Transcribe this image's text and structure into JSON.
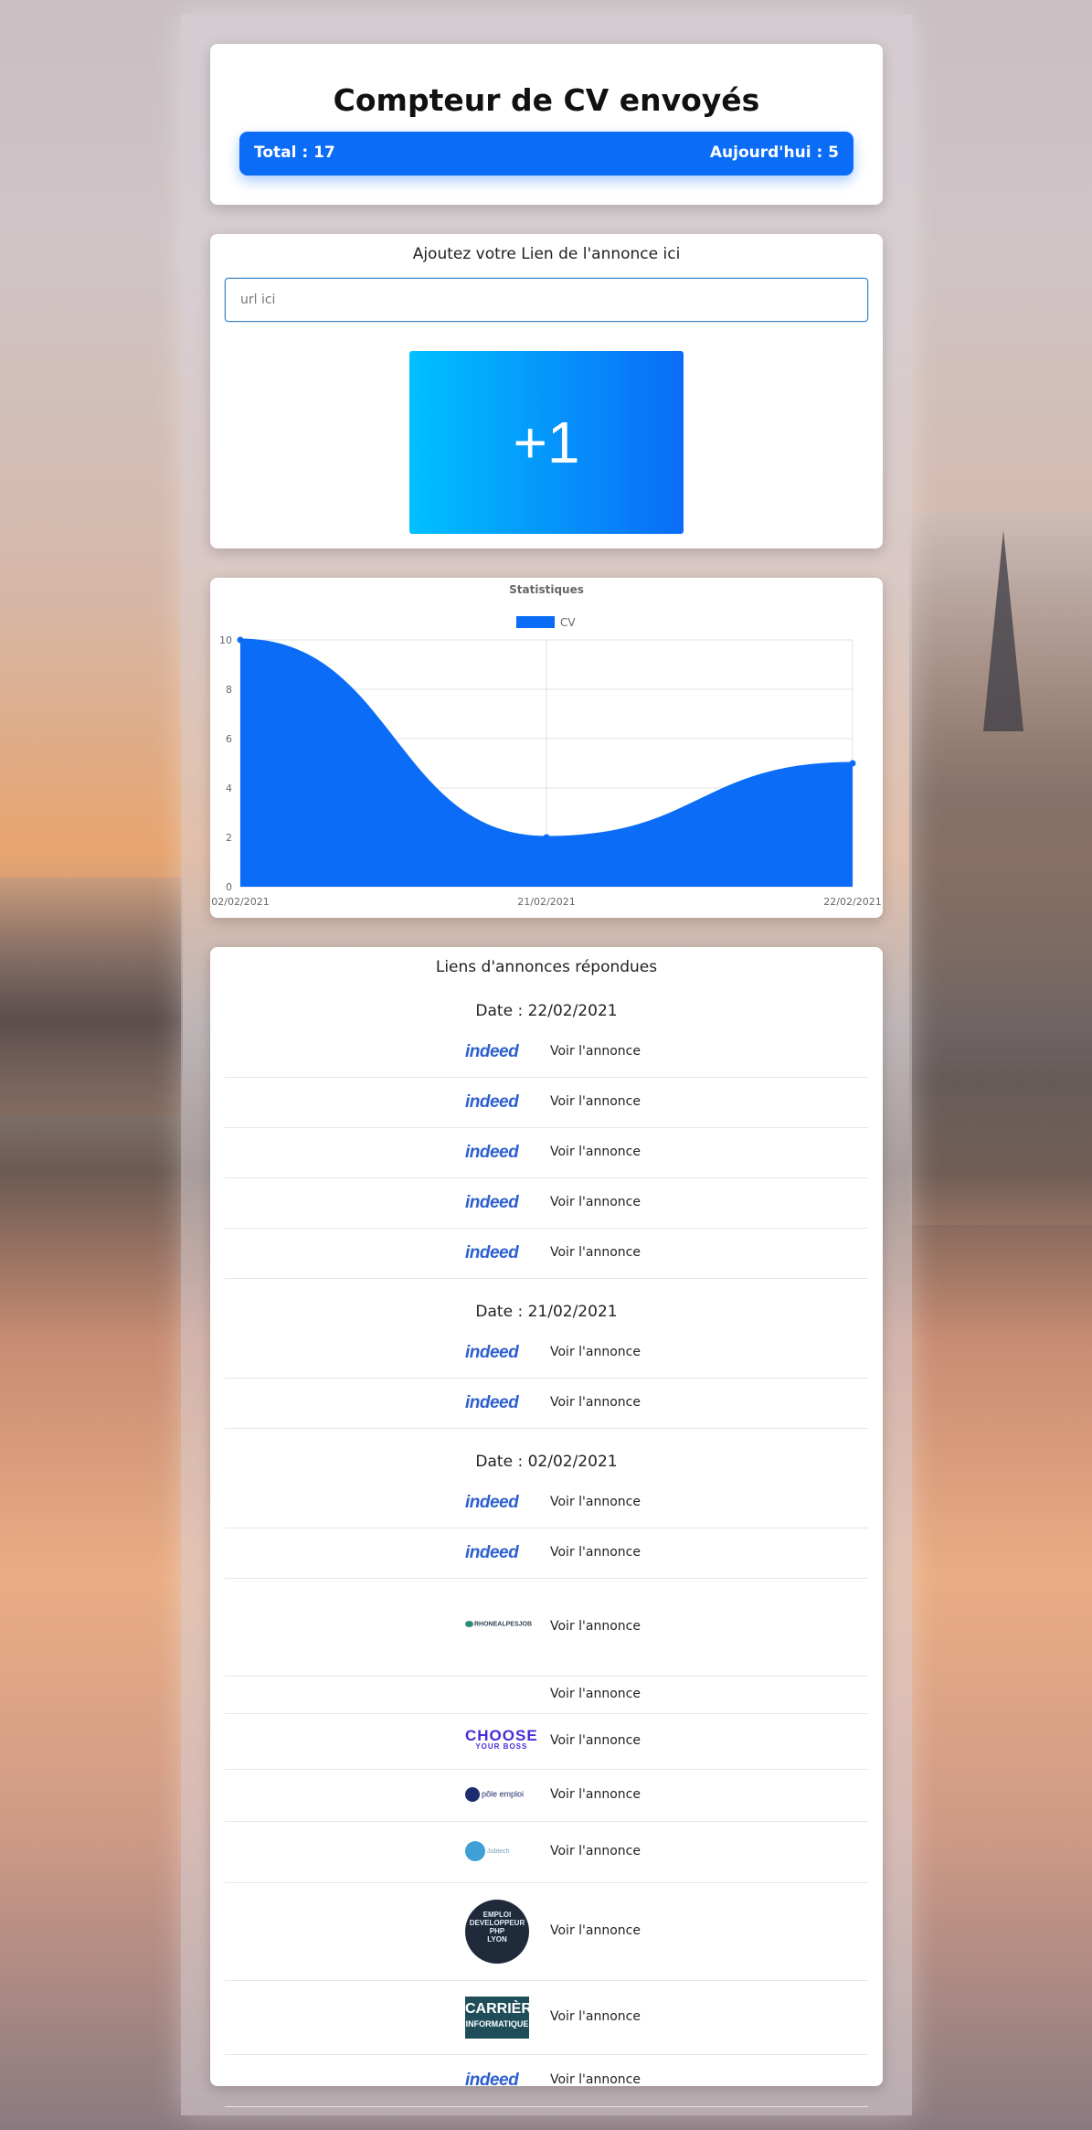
{
  "counter": {
    "title": "Compteur de CV envoyés",
    "total": "Total : 17",
    "today": "Aujourd'hui : 5"
  },
  "form": {
    "label": "Ajoutez votre Lien de l'annonce ici",
    "placeholder": "url ici",
    "button_label": "+1"
  },
  "chart_data": {
    "type": "area",
    "title": "Statistiques",
    "legend": [
      "CV"
    ],
    "legend_position": "top",
    "categories": [
      "02/02/2021",
      "21/02/2021",
      "22/02/2021"
    ],
    "series": [
      {
        "name": "CV",
        "values": [
          10,
          2,
          5
        ],
        "color": "#0a6cf7"
      }
    ],
    "ylim": [
      0,
      10
    ],
    "yticks": [
      0,
      2,
      4,
      6,
      8,
      10
    ],
    "grid": true
  },
  "links": {
    "title": "Liens d'annonces répondues",
    "link_label": "Voir l'annonce",
    "groups": [
      {
        "date": "Date : 22/02/2021",
        "logos": [
          "indeed",
          "indeed",
          "indeed",
          "indeed",
          "indeed"
        ]
      },
      {
        "date": "Date : 21/02/2021",
        "logos": [
          "indeed",
          "indeed"
        ]
      },
      {
        "date": "Date : 02/02/2021",
        "logos": [
          "indeed",
          "indeed",
          "rhonealpesjob",
          "none",
          "chooseyourboss",
          "pole-emploi",
          "jobtech",
          "developpeur-php-lyon",
          "carriere-informatique",
          "indeed"
        ]
      }
    ]
  },
  "logo_text": {
    "indeed": "indeed",
    "rhonealpesjob": "RHONEALPESJOB",
    "choose_big": "CHOOSE",
    "choose_small": "YOUR BOSS",
    "pole": "pôle emploi",
    "jobtech": "Jobtech",
    "php": [
      "EMPLOI",
      "DEVELOPPEUR",
      "PHP",
      "LYON"
    ],
    "carriere_1": "CARRIÈRE",
    "carriere_2": "INFORMATIQUE"
  }
}
